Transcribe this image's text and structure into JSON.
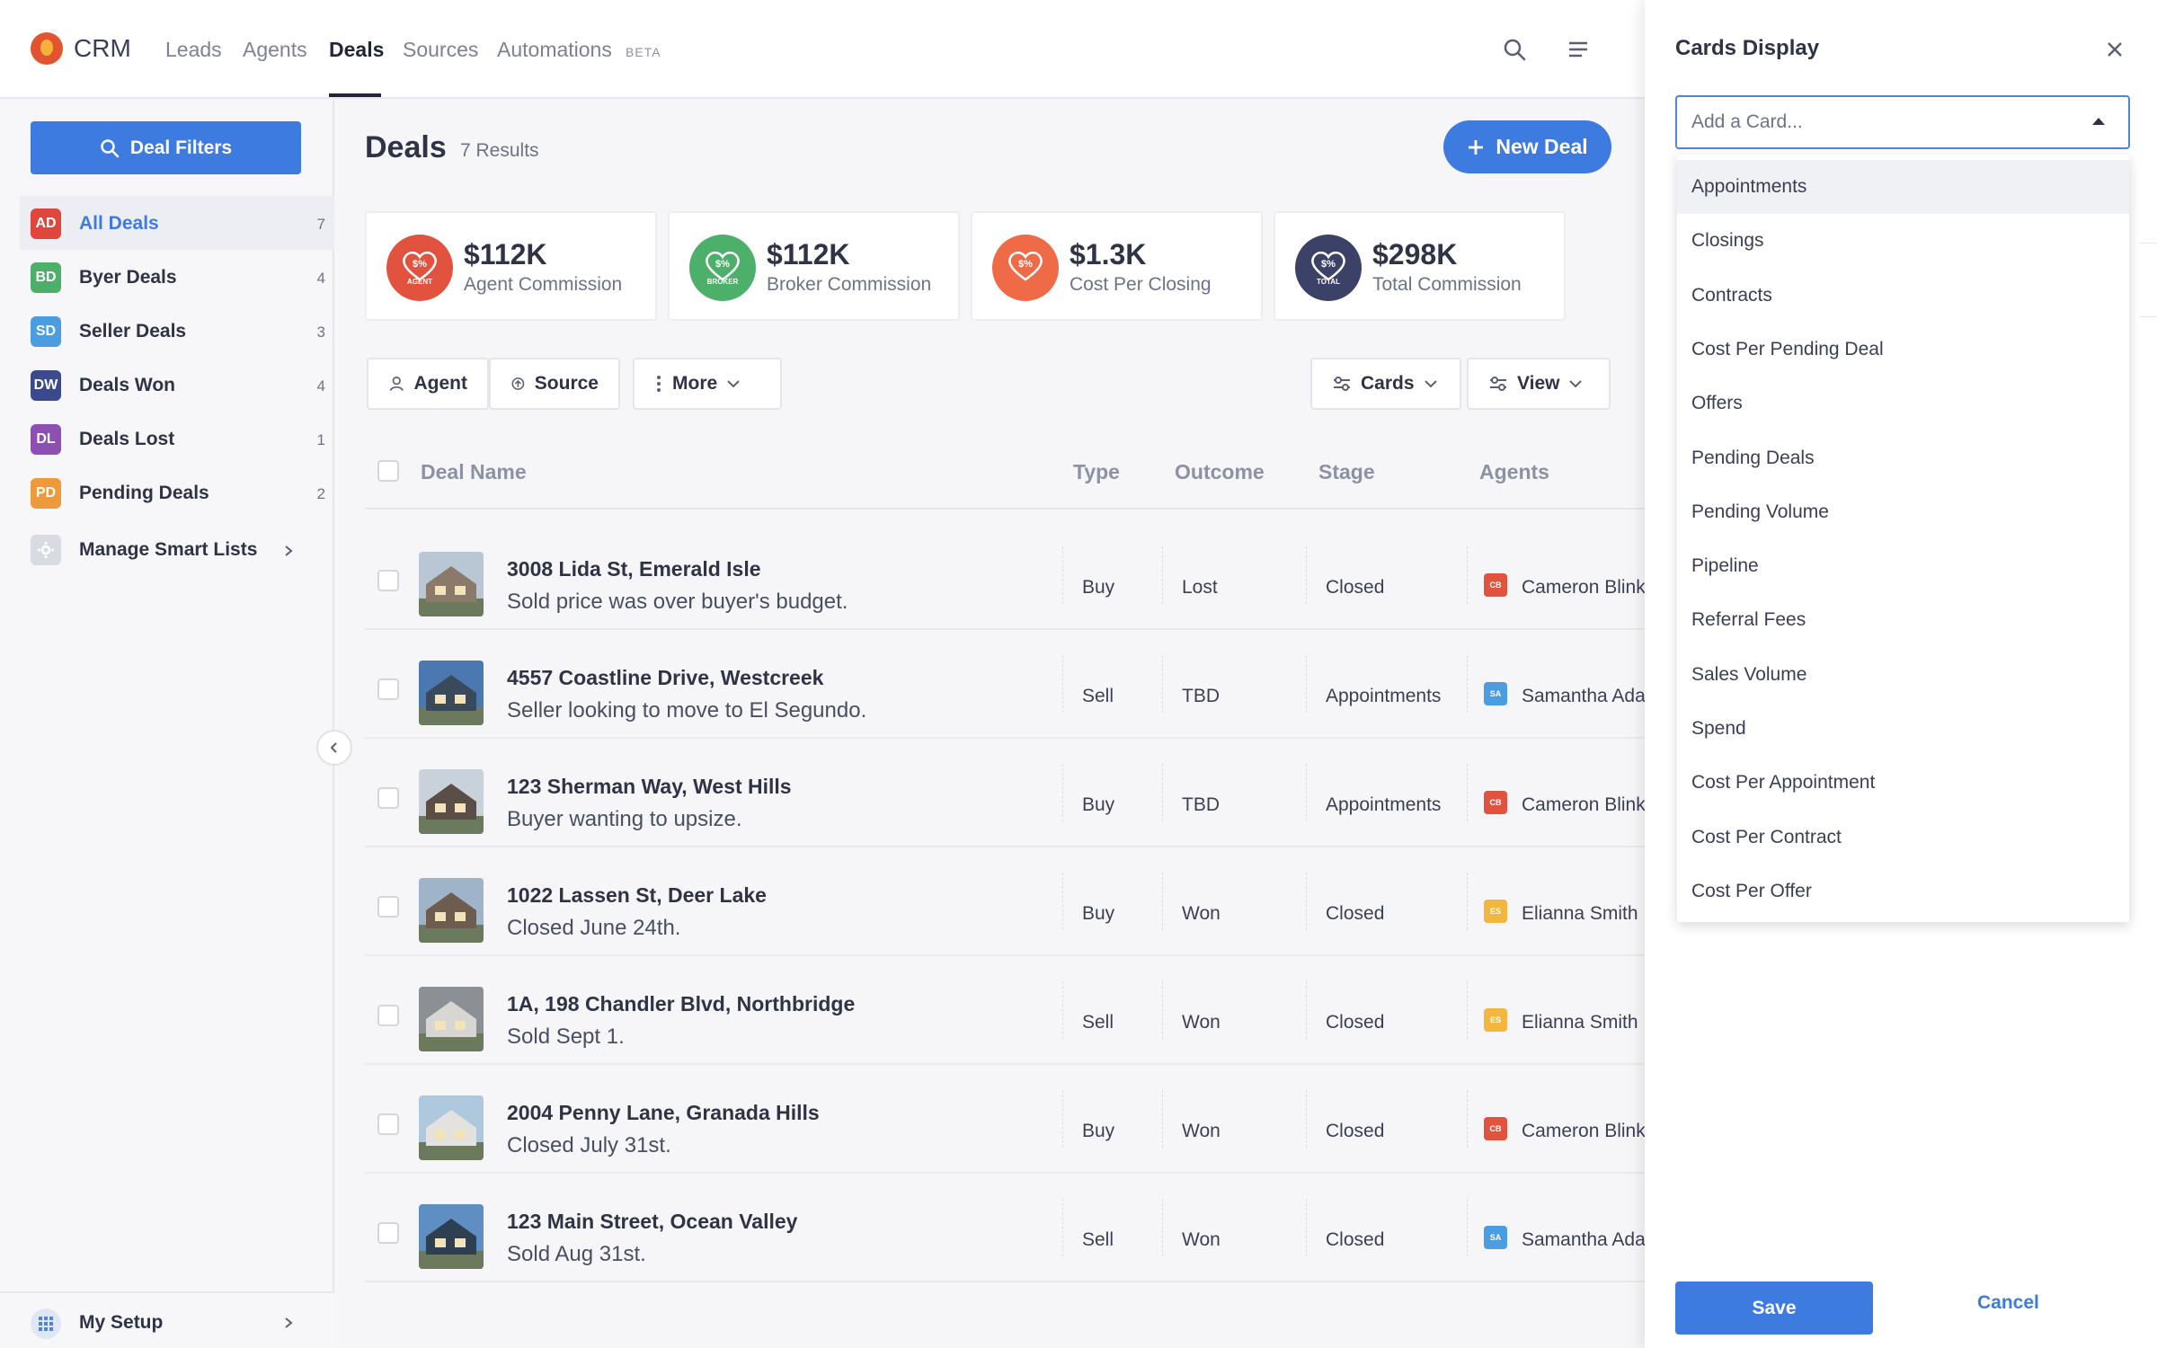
{
  "app": {
    "brand": "CRM"
  },
  "nav": {
    "items": [
      "Leads",
      "Agents",
      "Deals",
      "Sources",
      "Automations"
    ],
    "active": "Deals",
    "beta_badge": "BETA"
  },
  "sidebar": {
    "filter_button": "Deal Filters",
    "items": [
      {
        "badge": "AD",
        "label": "All Deals",
        "count": "7",
        "color": "#e0473c"
      },
      {
        "badge": "BD",
        "label": "Byer Deals",
        "count": "4",
        "color": "#4caf6a"
      },
      {
        "badge": "SD",
        "label": "Seller Deals",
        "count": "3",
        "color": "#4a9de0"
      },
      {
        "badge": "DW",
        "label": "Deals Won",
        "count": "4",
        "color": "#3b4a8c"
      },
      {
        "badge": "DL",
        "label": "Deals Lost",
        "count": "1",
        "color": "#8e4fb3"
      },
      {
        "badge": "PD",
        "label": "Pending Deals",
        "count": "2",
        "color": "#ef9a3a"
      }
    ],
    "manage": "Manage Smart Lists",
    "setup": "My Setup"
  },
  "page": {
    "title": "Deals",
    "results": "7 Results",
    "new_deal": "New Deal"
  },
  "stats": [
    {
      "amount": "$112K",
      "label": "Agent Commission",
      "tag": "AGENT",
      "color": "#e2533f"
    },
    {
      "amount": "$112K",
      "label": "Broker Commission",
      "tag": "BROKER",
      "color": "#4caf6a"
    },
    {
      "amount": "$1.3K",
      "label": "Cost Per Closing",
      "tag": "",
      "color": "#ef6a46"
    },
    {
      "amount": "$298K",
      "label": "Total Commission",
      "tag": "TOTAL",
      "color": "#3b4167"
    }
  ],
  "toolbar": {
    "agent": "Agent",
    "source": "Source",
    "more": "More",
    "cards": "Cards",
    "view": "View"
  },
  "table": {
    "headers": {
      "name": "Deal Name",
      "type": "Type",
      "outcome": "Outcome",
      "stage": "Stage",
      "agents": "Agents"
    },
    "rows": [
      {
        "title": "3008 Lida St, Emerald Isle",
        "sub": "Sold price was over buyer's budget.",
        "type": "Buy",
        "outcome": "Lost",
        "stage": "Closed",
        "agent": "Cameron Blink",
        "ab": "CB",
        "ac": "#e2533f",
        "sky": "#b9c6d3",
        "house": "#8b7a6a"
      },
      {
        "title": "4557 Coastline Drive, Westcreek",
        "sub": "Seller looking to move to El Segundo.",
        "type": "Sell",
        "outcome": "TBD",
        "stage": "Appointments",
        "agent": "Samantha Adams",
        "ab": "SA",
        "ac": "#4a9de0",
        "sky": "#4b78b0",
        "house": "#3a4a5a"
      },
      {
        "title": "123 Sherman Way, West Hills",
        "sub": "Buyer wanting to upsize.",
        "type": "Buy",
        "outcome": "TBD",
        "stage": "Appointments",
        "agent": "Cameron Blink",
        "ab": "CB",
        "ac": "#e2533f",
        "sky": "#c9d2da",
        "house": "#5a4e46"
      },
      {
        "title": "1022 Lassen St, Deer Lake",
        "sub": "Closed June 24th.",
        "type": "Buy",
        "outcome": "Won",
        "stage": "Closed",
        "agent": "Elianna Smith",
        "ab": "ES",
        "ac": "#f3b63f",
        "sky": "#9fb4c9",
        "house": "#6e5d4e"
      },
      {
        "title": "1A, 198 Chandler Blvd, Northbridge",
        "sub": "Sold Sept 1.",
        "type": "Sell",
        "outcome": "Won",
        "stage": "Closed",
        "agent": "Elianna Smith",
        "ab": "ES",
        "ac": "#f3b63f",
        "sky": "#8c8f94",
        "house": "#d8d6d2"
      },
      {
        "title": "2004 Penny Lane, Granada Hills",
        "sub": "Closed July 31st.",
        "type": "Buy",
        "outcome": "Won",
        "stage": "Closed",
        "agent": "Cameron Blink",
        "ab": "CB",
        "ac": "#e2533f",
        "sky": "#aec8de",
        "house": "#e4e2de"
      },
      {
        "title": "123 Main Street, Ocean Valley",
        "sub": "Sold Aug 31st.",
        "type": "Sell",
        "outcome": "Won",
        "stage": "Closed",
        "agent": "Samantha Adams",
        "ab": "SA",
        "ac": "#4a9de0",
        "sky": "#5f8fc2",
        "house": "#2f3f52"
      }
    ]
  },
  "panel": {
    "title": "Cards Display",
    "placeholder": "Add a Card...",
    "options": [
      "Appointments",
      "Closings",
      "Contracts",
      "Cost Per Pending Deal",
      "Offers",
      "Pending Deals",
      "Pending Volume",
      "Pipeline",
      "Referral Fees",
      "Sales Volume",
      "Spend",
      "Cost Per Appointment",
      "Cost Per Contract",
      "Cost Per Offer"
    ],
    "save": "Save",
    "cancel": "Cancel"
  }
}
